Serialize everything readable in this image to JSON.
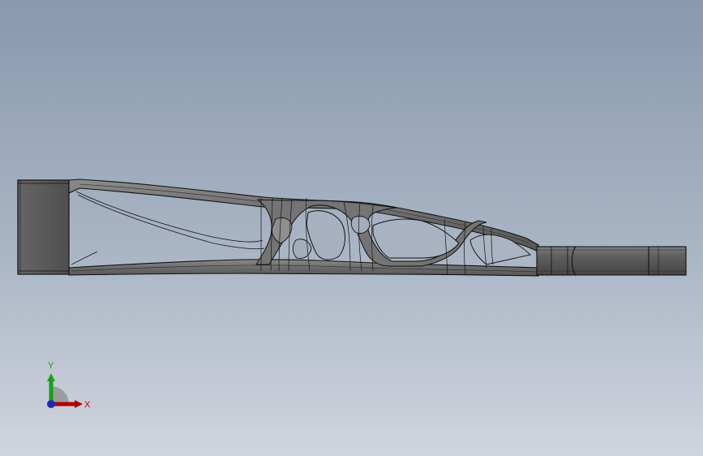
{
  "viewport": {
    "background_top": "#8a9bb0",
    "background_bottom": "#c9cfd9"
  },
  "model": {
    "body_color": "#6e6e6e",
    "edge_color": "#111111",
    "end_block_color": "#5c5c5c"
  },
  "triad": {
    "x_label": "X",
    "y_label": "Y",
    "x_color": "#c00000",
    "y_color": "#16a018",
    "z_color": "#1c2ab8"
  }
}
